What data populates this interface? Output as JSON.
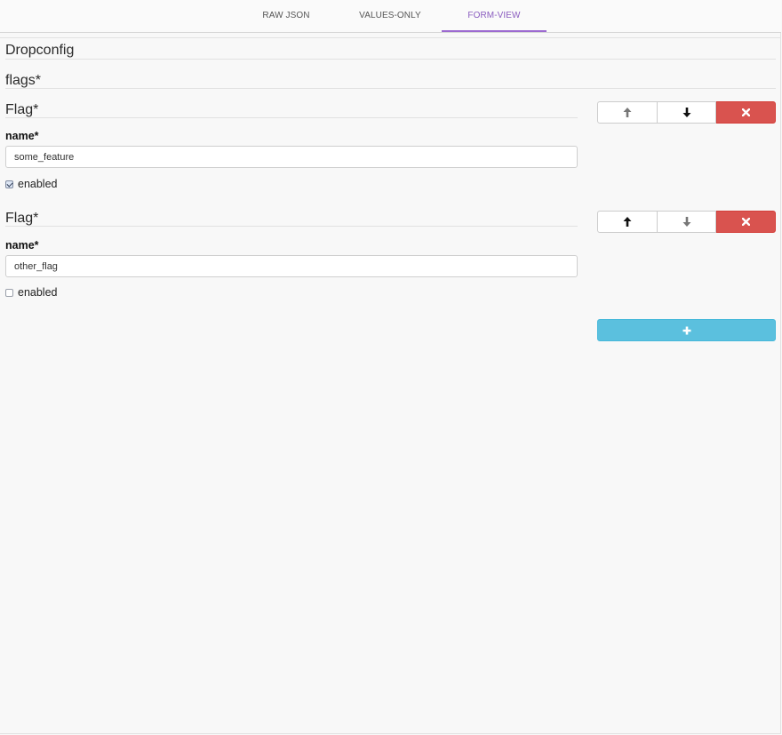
{
  "tabs": [
    {
      "label": "RAW JSON",
      "active": false
    },
    {
      "label": "VALUES-ONLY",
      "active": false
    },
    {
      "label": "FORM-VIEW",
      "active": true
    }
  ],
  "form": {
    "title": "Dropconfig",
    "array_title": "flags*",
    "items": [
      {
        "title": "Flag*",
        "name_label": "name*",
        "name_value": "some_feature",
        "enabled_label": "enabled",
        "enabled": true,
        "move_up_enabled": false,
        "move_down_enabled": true
      },
      {
        "title": "Flag*",
        "name_label": "name*",
        "name_value": "other_flag",
        "enabled_label": "enabled",
        "enabled": false,
        "move_up_enabled": true,
        "move_down_enabled": false
      }
    ],
    "add_button_icon": "plus-icon"
  },
  "colors": {
    "active_tab": "#8a5cbf",
    "delete_button": "#d9534f",
    "add_button": "#5bc0de"
  },
  "icons": {
    "move_up": "arrow-up-icon",
    "move_down": "arrow-down-icon",
    "remove": "close-icon",
    "add": "plus-icon"
  }
}
